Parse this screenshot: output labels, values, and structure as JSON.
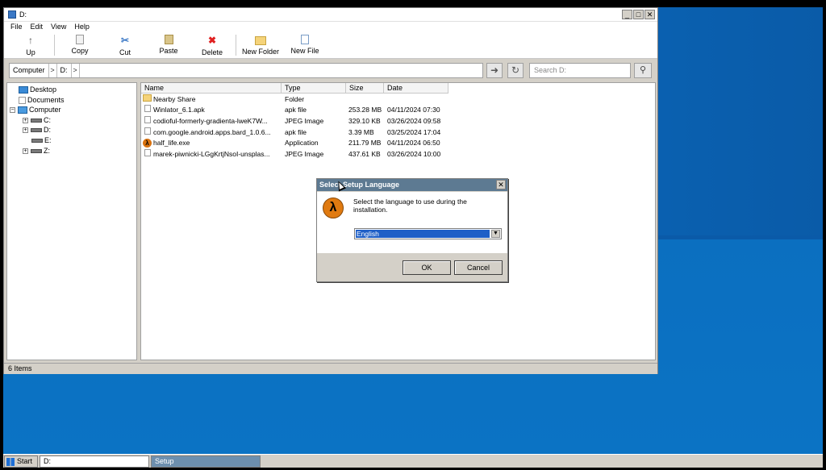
{
  "window": {
    "title": "D:",
    "controls": [
      "_",
      "□",
      "✕"
    ]
  },
  "menu": [
    "File",
    "Edit",
    "View",
    "Help"
  ],
  "toolbar": {
    "up": "Up",
    "copy": "Copy",
    "cut": "Cut",
    "paste": "Paste",
    "delete": "Delete",
    "new_folder": "New Folder",
    "new_file": "New File"
  },
  "address": {
    "crumbs": [
      "Computer",
      "D:"
    ],
    "search_placeholder": "Search D:"
  },
  "tree": [
    {
      "label": "Desktop"
    },
    {
      "label": "Documents"
    },
    {
      "label": "Computer"
    },
    {
      "label": "C:"
    },
    {
      "label": "D:"
    },
    {
      "label": "E:"
    },
    {
      "label": "Z:"
    }
  ],
  "columns": [
    "Name",
    "Type",
    "Size",
    "Date"
  ],
  "files": [
    {
      "name": "Nearby Share",
      "type": "Folder",
      "size": "",
      "date": "",
      "icon": "folder-icon"
    },
    {
      "name": "Winlator_6.1.apk",
      "type": "apk file",
      "size": "253.28 MB",
      "date": "04/11/2024 07:30",
      "icon": "file-icon"
    },
    {
      "name": "codioful-formerly-gradienta-lweK7W...",
      "type": "JPEG Image",
      "size": "329.10 KB",
      "date": "03/26/2024 09:58",
      "icon": "file-icon"
    },
    {
      "name": "com.google.android.apps.bard_1.0.6...",
      "type": "apk file",
      "size": "3.39 MB",
      "date": "03/25/2024 17:04",
      "icon": "file-icon"
    },
    {
      "name": "half_life.exe",
      "type": "Application",
      "size": "211.79 MB",
      "date": "04/11/2024 06:50",
      "icon": "half-life-icon"
    },
    {
      "name": "marek-piwnicki-LGgKrtjNsoI-unsplas...",
      "type": "JPEG Image",
      "size": "437.61 KB",
      "date": "03/26/2024 10:00",
      "icon": "file-icon"
    }
  ],
  "status": "6 Items",
  "dialog": {
    "title": "Select Setup Language",
    "message": "Select the language to use during the installation.",
    "selected_language": "English",
    "ok": "OK",
    "cancel": "Cancel",
    "logo_glyph": "λ"
  },
  "taskbar": {
    "start": "Start",
    "tasks": [
      "D:",
      "Setup"
    ]
  }
}
